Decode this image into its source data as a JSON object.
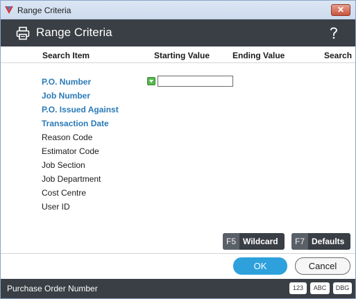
{
  "window": {
    "title": "Range Criteria"
  },
  "header": {
    "title": "Range Criteria",
    "print_icon": "printer-icon",
    "help_icon": "help-icon"
  },
  "columns": {
    "search_item": "Search Item",
    "starting_value": "Starting Value",
    "ending_value": "Ending Value",
    "search": "Search"
  },
  "items": [
    {
      "label": "P.O. Number",
      "highlighted": true
    },
    {
      "label": "Job Number",
      "highlighted": true
    },
    {
      "label": "P.O. Issued Against",
      "highlighted": true
    },
    {
      "label": "Transaction Date",
      "highlighted": true
    },
    {
      "label": "Reason Code",
      "highlighted": false
    },
    {
      "label": "Estimator Code",
      "highlighted": false
    },
    {
      "label": "Job Section",
      "highlighted": false
    },
    {
      "label": "Job Department",
      "highlighted": false
    },
    {
      "label": "Cost Centre",
      "highlighted": false
    },
    {
      "label": "User ID",
      "highlighted": false
    }
  ],
  "starting_value": {
    "value": ""
  },
  "function_keys": {
    "wildcard": {
      "key": "F5",
      "label": "Wildcard"
    },
    "defaults": {
      "key": "F7",
      "label": "Defaults"
    }
  },
  "buttons": {
    "ok": "OK",
    "cancel": "Cancel"
  },
  "status": {
    "text": "Purchase Order Number",
    "badges": [
      "123",
      "ABC",
      "DBG"
    ]
  },
  "colors": {
    "header_bg": "#3a3f45",
    "accent_blue": "#2a7ab8",
    "ok_blue": "#2ea1dd",
    "lookup_green": "#55b84c",
    "close_red": "#c9543e"
  }
}
